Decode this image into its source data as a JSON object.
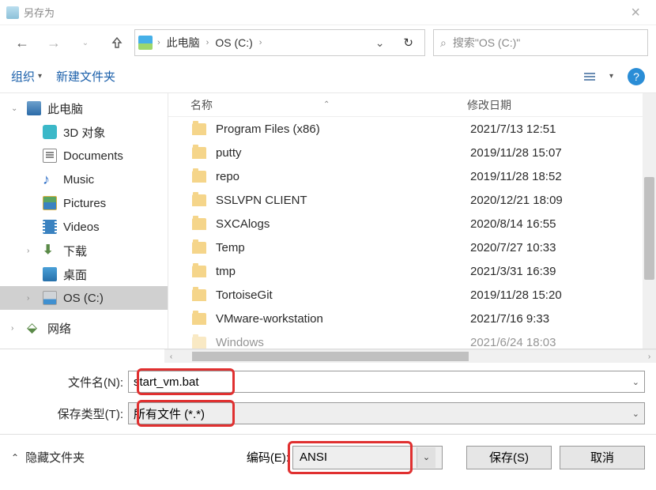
{
  "title": "另存为",
  "breadcrumb": {
    "pc": "此电脑",
    "drive": "OS (C:)"
  },
  "search": {
    "placeholder": "搜索\"OS (C:)\""
  },
  "toolbar": {
    "organize": "组织",
    "newfolder": "新建文件夹"
  },
  "columns": {
    "name": "名称",
    "date": "修改日期"
  },
  "sidebar": {
    "pc": "此电脑",
    "items": [
      {
        "label": "3D 对象"
      },
      {
        "label": "Documents"
      },
      {
        "label": "Music"
      },
      {
        "label": "Pictures"
      },
      {
        "label": "Videos"
      },
      {
        "label": "下载"
      },
      {
        "label": "桌面"
      },
      {
        "label": "OS (C:)"
      }
    ],
    "network": "网络"
  },
  "files": [
    {
      "name": "Program Files (x86)",
      "date": "2021/7/13 12:51"
    },
    {
      "name": "putty",
      "date": "2019/11/28 15:07"
    },
    {
      "name": "repo",
      "date": "2019/11/28 18:52"
    },
    {
      "name": "SSLVPN CLIENT",
      "date": "2020/12/21 18:09"
    },
    {
      "name": "SXCAlogs",
      "date": "2020/8/14 16:55"
    },
    {
      "name": "Temp",
      "date": "2020/7/27 10:33"
    },
    {
      "name": "tmp",
      "date": "2021/3/31 16:39"
    },
    {
      "name": "TortoiseGit",
      "date": "2019/11/28 15:20"
    },
    {
      "name": "VMware-workstation",
      "date": "2021/7/16 9:33"
    },
    {
      "name": "Windows",
      "date": "2021/6/24 18:03"
    }
  ],
  "form": {
    "filename_label": "文件名(N):",
    "filename_value": "start_vm.bat",
    "filetype_label": "保存类型(T):",
    "filetype_value": "所有文件  (*.*)"
  },
  "footer": {
    "hide": "隐藏文件夹",
    "encoding_label": "编码(E):",
    "encoding_value": "ANSI",
    "save": "保存(S)",
    "cancel": "取消"
  }
}
